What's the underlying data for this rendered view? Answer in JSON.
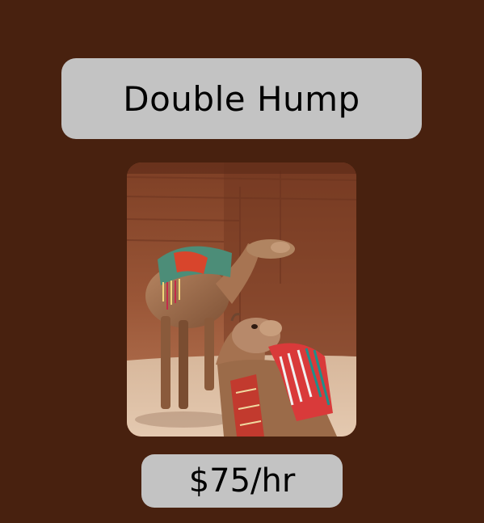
{
  "card": {
    "title": "Double Hump",
    "price": "$75/hr"
  },
  "image": {
    "subject": "two camels with colorful saddle blankets in front of sandstone cliff"
  },
  "colors": {
    "background": "#48210f",
    "panel": "#c3c3c3",
    "text": "#000000"
  }
}
